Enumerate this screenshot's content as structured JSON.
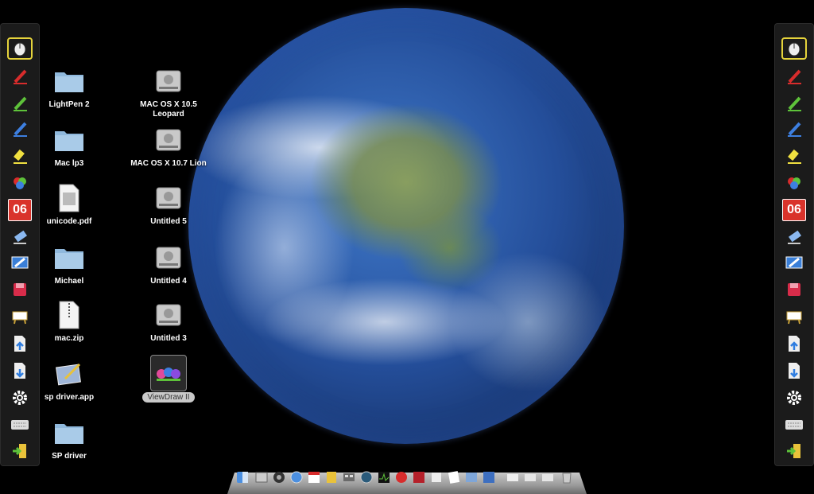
{
  "desktop": {
    "icons_left": [
      {
        "label": "LightPen 2",
        "icon": "folder-icon"
      },
      {
        "label": "Mac lp3",
        "icon": "folder-icon"
      },
      {
        "label": "unicode.pdf",
        "icon": "pdf-document-icon"
      },
      {
        "label": "Michael",
        "icon": "folder-icon"
      },
      {
        "label": "mac.zip",
        "icon": "zip-file-icon"
      },
      {
        "label": "sp driver.app",
        "icon": "app-icon"
      },
      {
        "label": "SP driver",
        "icon": "folder-icon"
      }
    ],
    "icons_right": [
      {
        "label": "MAC OS X 10.5 Leopard",
        "icon": "hard-drive-icon"
      },
      {
        "label": "MAC OS X 10.7 Lion",
        "icon": "hard-drive-icon"
      },
      {
        "label": "Untitled 5",
        "icon": "hard-drive-icon"
      },
      {
        "label": "Untitled 4",
        "icon": "hard-drive-icon"
      },
      {
        "label": "Untitled 3",
        "icon": "hard-drive-icon"
      },
      {
        "label": "ViewDraw II",
        "icon": "viewdraw-app-icon",
        "selected": true
      }
    ]
  },
  "palette": {
    "calendar_value": "06",
    "tools": [
      "mouse-pointer-icon",
      "red-pen-icon",
      "green-pen-icon",
      "blue-pen-icon",
      "yellow-highlighter-icon",
      "color-picker-icon",
      "calendar-icon",
      "eraser-icon",
      "clear-screen-icon",
      "save-icon",
      "whiteboard-icon",
      "import-icon",
      "export-icon",
      "settings-gear-icon",
      "keyboard-icon",
      "exit-icon"
    ],
    "highlight_color": "#e5d33b"
  },
  "dock": {
    "items": [
      "finder-icon",
      "launchpad-icon",
      "dashboard-icon",
      "safari-icon",
      "calendar-icon",
      "notes-icon",
      "mission-control-icon",
      "time-machine-icon",
      "activity-monitor-icon",
      "game-icon",
      "flash-icon",
      "preview-icon",
      "textedit-icon",
      "photo-icon",
      "xcode-icon",
      "mail-icon",
      "document-icon",
      "document-icon",
      "trash-icon"
    ]
  }
}
